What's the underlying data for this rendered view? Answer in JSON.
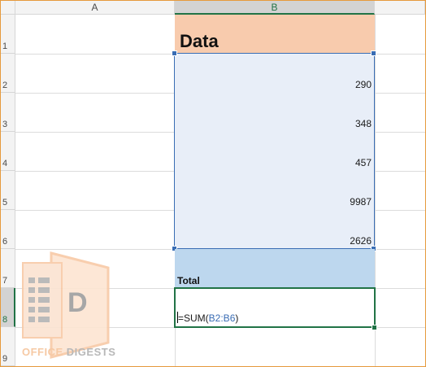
{
  "columns": {
    "a": "A",
    "b": "B"
  },
  "rows": [
    "1",
    "2",
    "3",
    "4",
    "5",
    "6",
    "7",
    "8",
    "9"
  ],
  "cells": {
    "b1": "Data",
    "b2": "290",
    "b3": "348",
    "b4": "457",
    "b5": "9987",
    "b6": "2626",
    "b7": "Total",
    "b8_formula_prefix": "=SUM(",
    "b8_formula_ref": "B2:B6",
    "b8_formula_suffix": ")"
  },
  "watermark": {
    "word1": "OFFICE",
    "word2": "DIGESTS",
    "logo_letter": "D"
  },
  "colors": {
    "header_fill": "#f8cbad",
    "data_fill": "#e8eef8",
    "total_fill": "#bdd7ee",
    "active_border": "#217346",
    "range_border": "#3a6db4"
  }
}
